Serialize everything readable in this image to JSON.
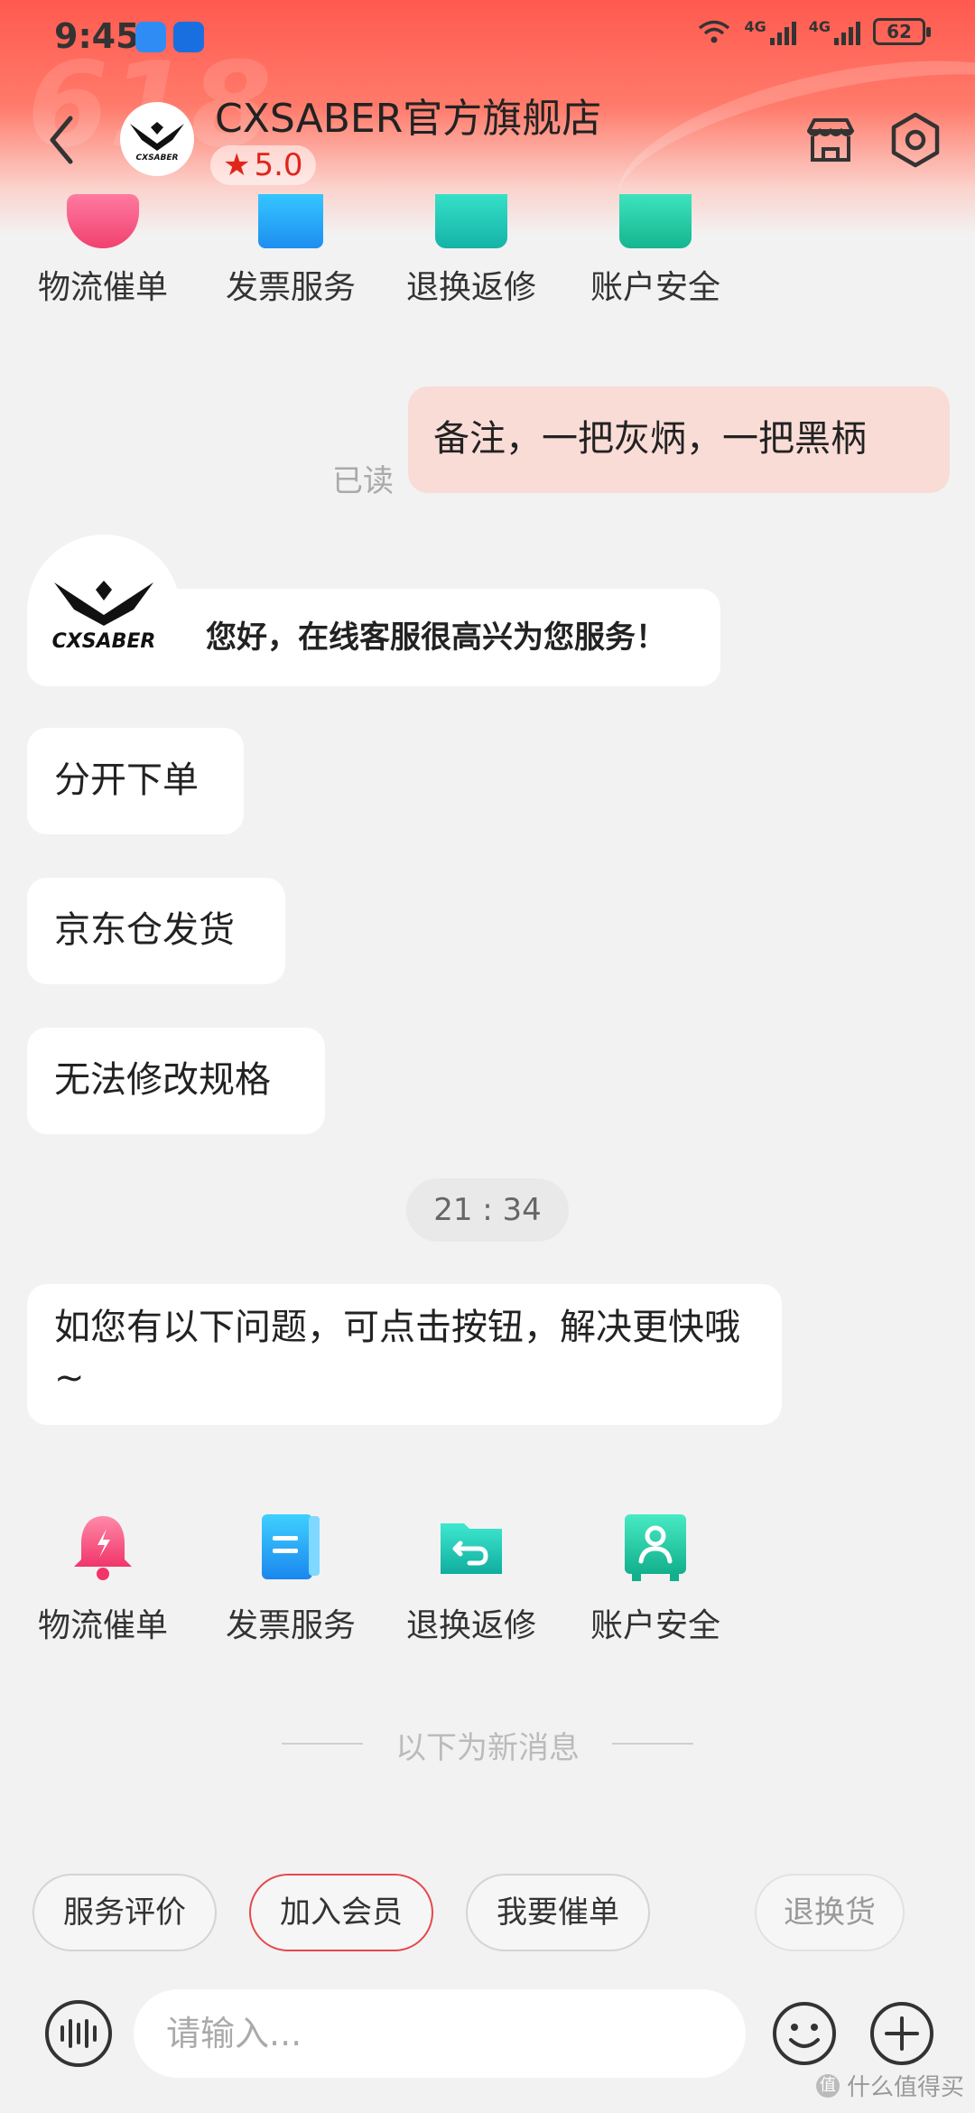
{
  "status_bar": {
    "time": "9:45",
    "network1": "4G",
    "network2": "4G",
    "battery": "62"
  },
  "header": {
    "shop_name": "CXSABER官方旗舰店",
    "rating": "5.0",
    "logo_text": "CXSABER",
    "decor_text": "618"
  },
  "quick_actions_top": [
    {
      "label": "物流催单",
      "icon": "bell-icon"
    },
    {
      "label": "发票服务",
      "icon": "invoice-icon"
    },
    {
      "label": "退换返修",
      "icon": "return-icon"
    },
    {
      "label": "账户安全",
      "icon": "account-security-icon"
    }
  ],
  "messages": {
    "mine_1": "备注，一把灰炳，一把黑柄",
    "read_label": "已读",
    "greeting": "您好，在线客服很高兴为您服务！",
    "bot_logo_text": "CXSABER",
    "m1": "分开下单",
    "m2": "京东仓发货",
    "m3": "无法修改规格",
    "timestamp": "21 : 34",
    "m4": "如您有以下问题，可点击按钮，解决更快哦~"
  },
  "quick_actions_bottom": [
    {
      "label": "物流催单",
      "icon": "bell-icon"
    },
    {
      "label": "发票服务",
      "icon": "invoice-icon"
    },
    {
      "label": "退换返修",
      "icon": "return-icon"
    },
    {
      "label": "账户安全",
      "icon": "account-security-icon"
    }
  ],
  "divider_text": "以下为新消息",
  "chips": [
    "服务评价",
    "加入会员",
    "我要催单",
    "退换货"
  ],
  "input": {
    "placeholder": "请输入..."
  },
  "watermark": "什么值得买",
  "colors": {
    "header_red": "#ff5a4f",
    "accent_red": "#e5484d",
    "bubble_mine": "#f9dcd6",
    "bell_pink": "#f0416e",
    "invoice_blue": "#1da2f0",
    "return_teal": "#1fc4b4",
    "account_green": "#20bfa0"
  }
}
